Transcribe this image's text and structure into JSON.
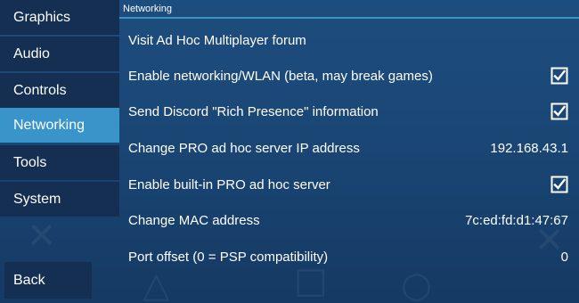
{
  "sidebar": {
    "items": [
      {
        "label": "Graphics",
        "active": false
      },
      {
        "label": "Audio",
        "active": false
      },
      {
        "label": "Controls",
        "active": false
      },
      {
        "label": "Networking",
        "active": true
      },
      {
        "label": "Tools",
        "active": false
      },
      {
        "label": "System",
        "active": false
      }
    ],
    "back_label": "Back"
  },
  "panel": {
    "section_title": "Networking",
    "rows": [
      {
        "label": "Visit Ad Hoc Multiplayer forum",
        "value": null,
        "checked": null
      },
      {
        "label": "Enable networking/WLAN (beta, may break games)",
        "value": null,
        "checked": true
      },
      {
        "label": "Send Discord \"Rich Presence\" information",
        "value": null,
        "checked": true
      },
      {
        "label": "Change PRO ad hoc server IP address",
        "value": "192.168.43.1",
        "checked": null
      },
      {
        "label": "Enable built-in PRO ad hoc server",
        "value": null,
        "checked": true
      },
      {
        "label": "Change MAC address",
        "value": "7c:ed:fd:d1:47:67",
        "checked": null
      },
      {
        "label": "Port offset (0 = PSP compatibility)",
        "value": "0",
        "checked": null
      }
    ]
  },
  "colors": {
    "active_tab": "#3894c9",
    "sidebar_item_bg": "#142f51",
    "background": "#1a4675"
  }
}
